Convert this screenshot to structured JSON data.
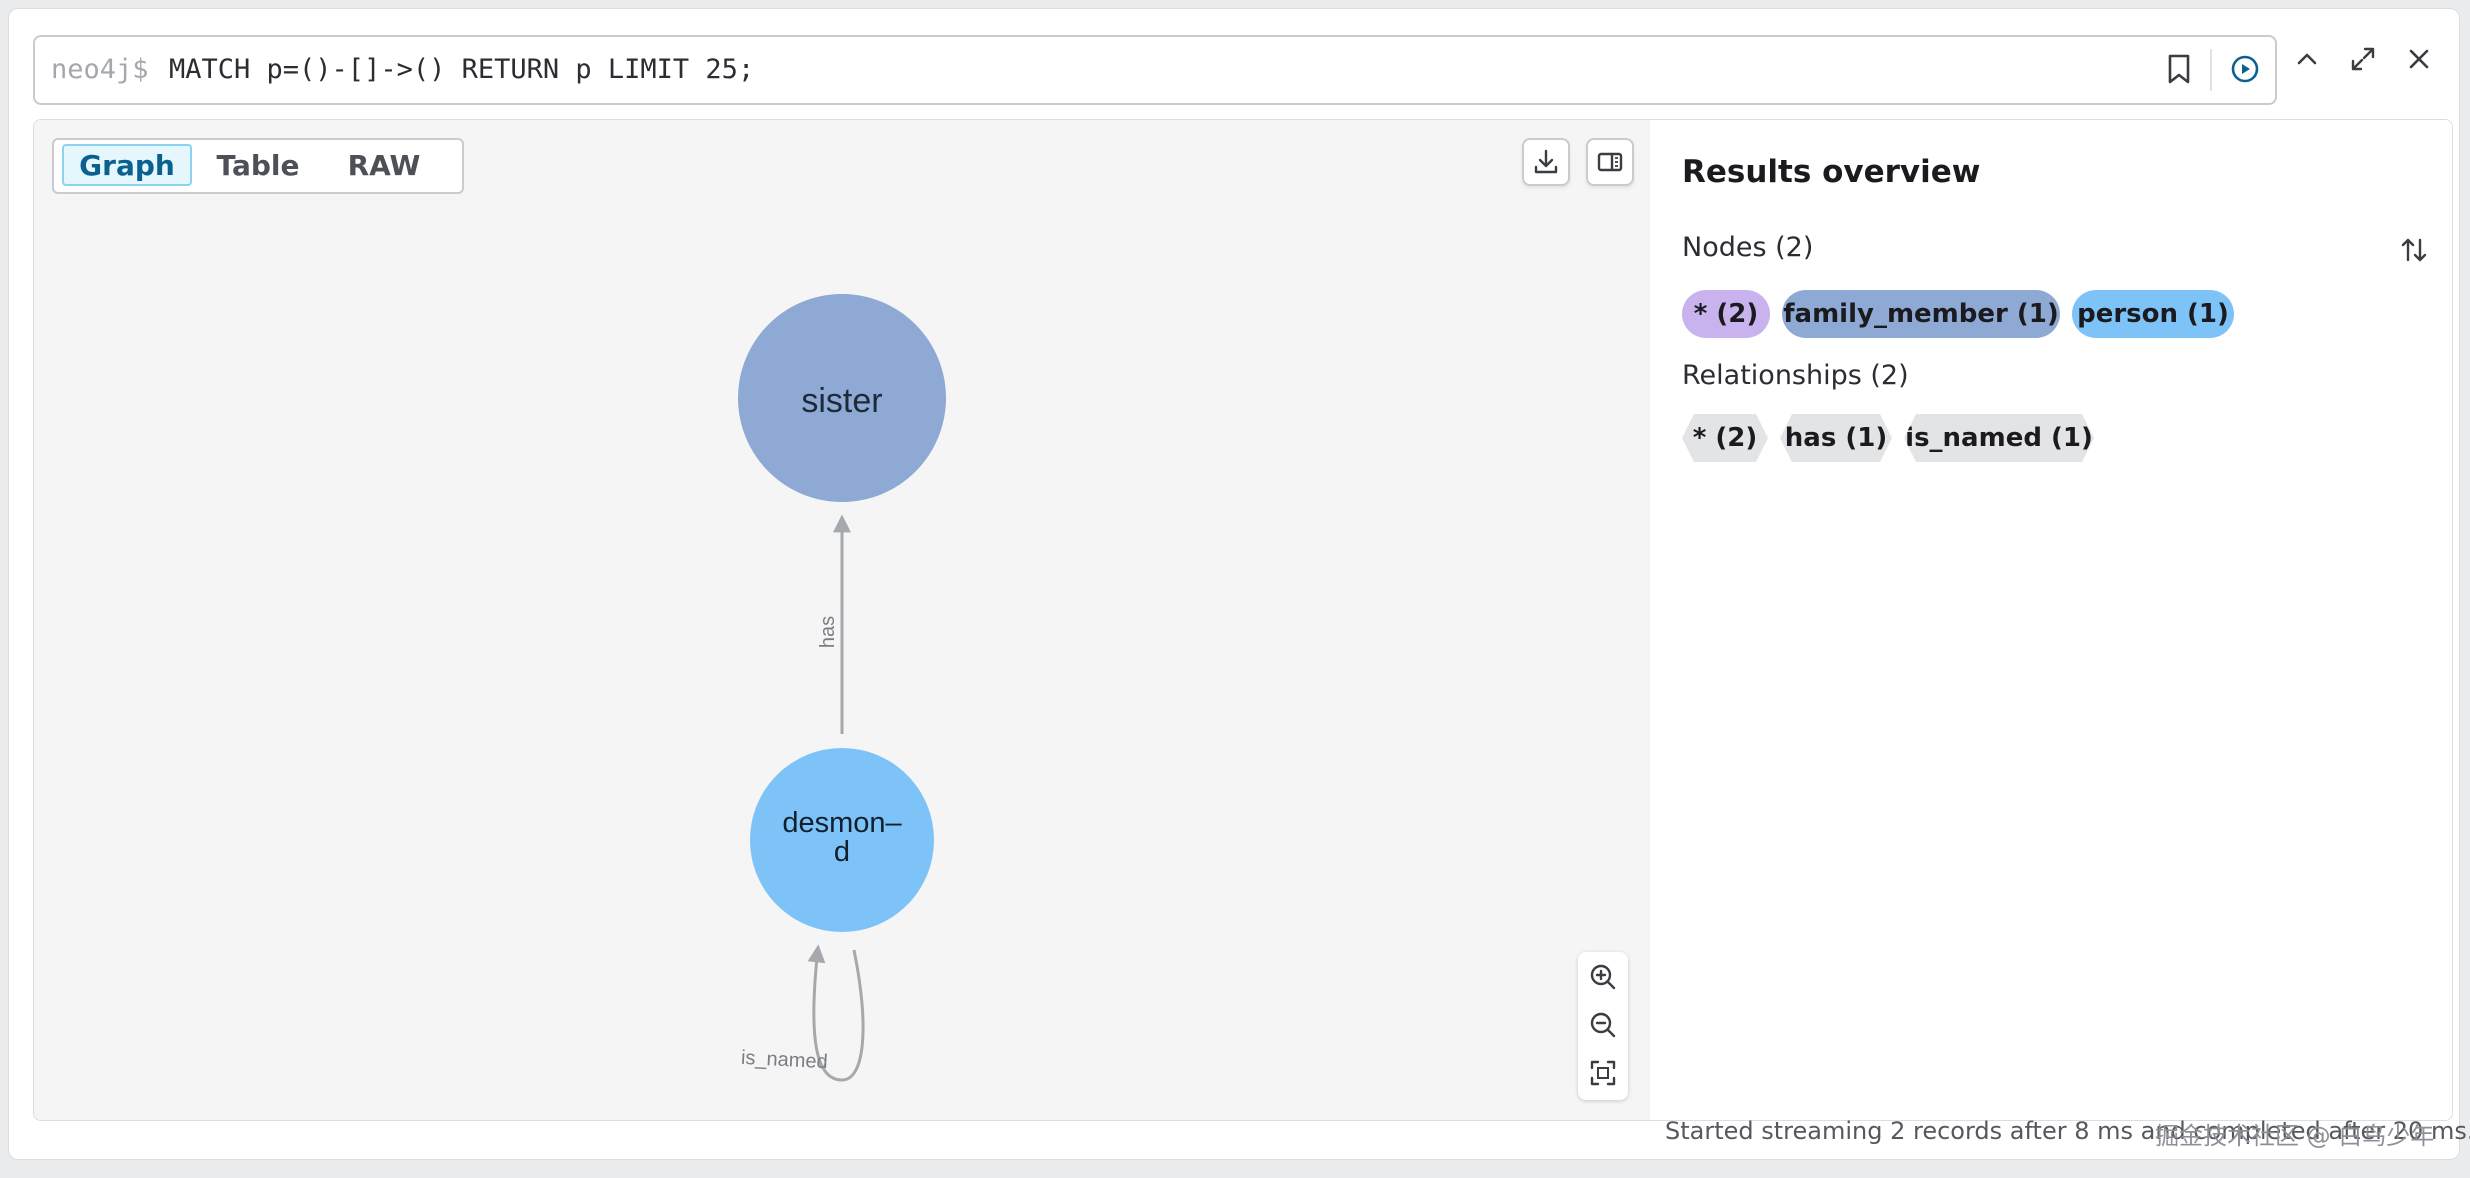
{
  "editor": {
    "prompt": "neo4j$",
    "query": "MATCH p=()-[]->() RETURN p LIMIT 25;"
  },
  "view_tabs": [
    {
      "label": "Graph",
      "active": true
    },
    {
      "label": "Table",
      "active": false
    },
    {
      "label": "RAW",
      "active": false
    }
  ],
  "graph": {
    "nodes": [
      {
        "id": "sister",
        "label_lines": [
          "sister"
        ],
        "color": "#8DA9D4"
      },
      {
        "id": "desmond",
        "label_lines": [
          "desmon–",
          "d"
        ],
        "color": "#7DC3F8"
      }
    ],
    "relationships": [
      {
        "type": "has",
        "from": "desmond",
        "to": "sister"
      },
      {
        "type": "is_named",
        "from": "desmond",
        "to": "desmond"
      }
    ],
    "edge_color": "#A5A8AD"
  },
  "overview": {
    "title": "Results overview",
    "nodes_label": "Nodes (2)",
    "node_chips": [
      {
        "label": "* (2)",
        "color": "#C8B3EE"
      },
      {
        "label": "family_member (1)",
        "color": "#8DA9D4"
      },
      {
        "label": "person (1)",
        "color": "#7DC3F8"
      }
    ],
    "relationships_label": "Relationships (2)",
    "rel_chips": [
      {
        "label": "* (2)"
      },
      {
        "label": "has (1)"
      },
      {
        "label": "is_named (1)"
      }
    ]
  },
  "status": "Started streaming 2 records after 8 ms and completed after 20 ms.",
  "watermark": "掘金技术社区 @ 白鸟少年",
  "icons": {
    "bookmark": "bookmark-icon",
    "run": "play-circle-icon",
    "collapse": "chevron-up-icon",
    "fullscreen": "expand-icon",
    "close": "close-icon",
    "download": "download-icon",
    "sidepanel": "side-panel-icon",
    "zoom_in": "zoom-in-icon",
    "zoom_out": "zoom-out-icon",
    "fit": "fit-to-screen-icon",
    "sort": "sort-icon"
  }
}
